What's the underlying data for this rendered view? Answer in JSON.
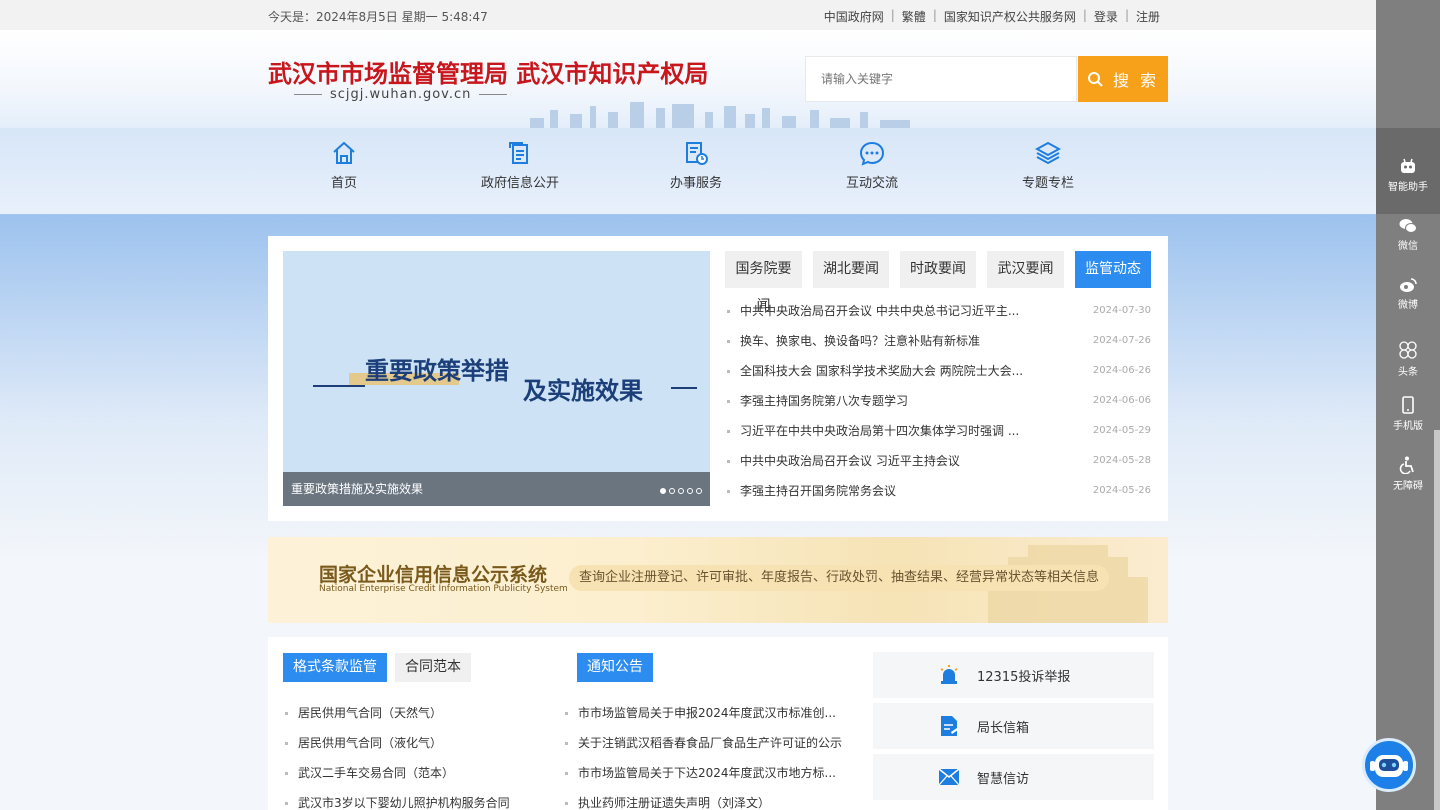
{
  "topbar": {
    "date_text": "今天是：2024年8月5日 星期一 5:48:47",
    "links": [
      "中国政府网",
      "繁體",
      "国家知识产权公共服务网",
      "登录",
      "注册"
    ]
  },
  "header": {
    "site_title": "武汉市市场监督管理局 武汉市知识产权局",
    "domain": "scjgj.wuhan.gov.cn",
    "search_placeholder": "请输入关键字",
    "search_button": "搜 索"
  },
  "nav": {
    "items": [
      {
        "label": "首页",
        "icon": "home-icon"
      },
      {
        "label": "政府信息公开",
        "icon": "document-icon"
      },
      {
        "label": "办事服务",
        "icon": "service-icon"
      },
      {
        "label": "互动交流",
        "icon": "chat-icon"
      },
      {
        "label": "专题专栏",
        "icon": "layers-icon"
      }
    ]
  },
  "slideshow": {
    "line1": "重要政策举措",
    "line2": "及实施效果",
    "caption": "重要政策措施及实施效果",
    "current_slide": 1,
    "total_slides": 5
  },
  "news": {
    "tabs": [
      "国务院要闻",
      "湖北要闻",
      "时政要闻",
      "武汉要闻",
      "监管动态"
    ],
    "active_tab": "监管动态",
    "items": [
      {
        "title": "中共中央政治局召开会议 中共中央总书记习近平主...",
        "date": "2024-07-30"
      },
      {
        "title": "换车、换家电、换设备吗？注意补贴有新标准",
        "date": "2024-07-26"
      },
      {
        "title": "全国科技大会 国家科学技术奖励大会 两院院士大会...",
        "date": "2024-06-26"
      },
      {
        "title": "李强主持国务院第八次专题学习",
        "date": "2024-06-06"
      },
      {
        "title": "习近平在中共中央政治局第十四次集体学习时强调 ...",
        "date": "2024-05-29"
      },
      {
        "title": "中共中央政治局召开会议 习近平主持会议",
        "date": "2024-05-28"
      },
      {
        "title": "李强主持召开国务院常务会议",
        "date": "2024-05-26"
      }
    ]
  },
  "banner": {
    "title_cn": "国家企业信用信息公示系统",
    "title_en": "National Enterprise Credit Information Publicity System",
    "description": "查询企业注册登记、许可审批、年度报告、行政处罚、抽查结果、经营异常状态等相关信息"
  },
  "contract": {
    "tabs": [
      "格式条款监管",
      "合同范本"
    ],
    "items": [
      "居民供用气合同（天然气）",
      "居民供用气合同（液化气）",
      "武汉二手车交易合同（范本）",
      "武汉市3岁以下婴幼儿照护机构服务合同"
    ]
  },
  "notice": {
    "tabs": [
      "通知公告"
    ],
    "items": [
      "市市场监管局关于申报2024年度武汉市标准创...",
      "关于注销武汉稻香春食品厂食品生产许可证的公示",
      "市市场监管局关于下达2024年度武汉市地方标...",
      "执业药师注册证遗失声明（刘泽文）"
    ]
  },
  "services": [
    {
      "label": "12315投诉举报",
      "icon": "alarm-icon"
    },
    {
      "label": "局长信箱",
      "icon": "letter-icon"
    },
    {
      "label": "智慧信访",
      "icon": "mail-icon"
    }
  ],
  "sidebar": {
    "items": [
      {
        "label": "智能助手",
        "icon": "robot-icon"
      },
      {
        "label": "微信",
        "icon": "wechat-icon"
      },
      {
        "label": "微博",
        "icon": "weibo-icon"
      },
      {
        "label": "头条",
        "icon": "toutiao-icon"
      },
      {
        "label": "手机版",
        "icon": "mobile-icon"
      },
      {
        "label": "无障碍",
        "icon": "accessibility-icon"
      }
    ]
  },
  "colors": {
    "brand_red": "#c8161d",
    "accent_blue": "#2d8cf0",
    "search_orange": "#f7a11b"
  }
}
